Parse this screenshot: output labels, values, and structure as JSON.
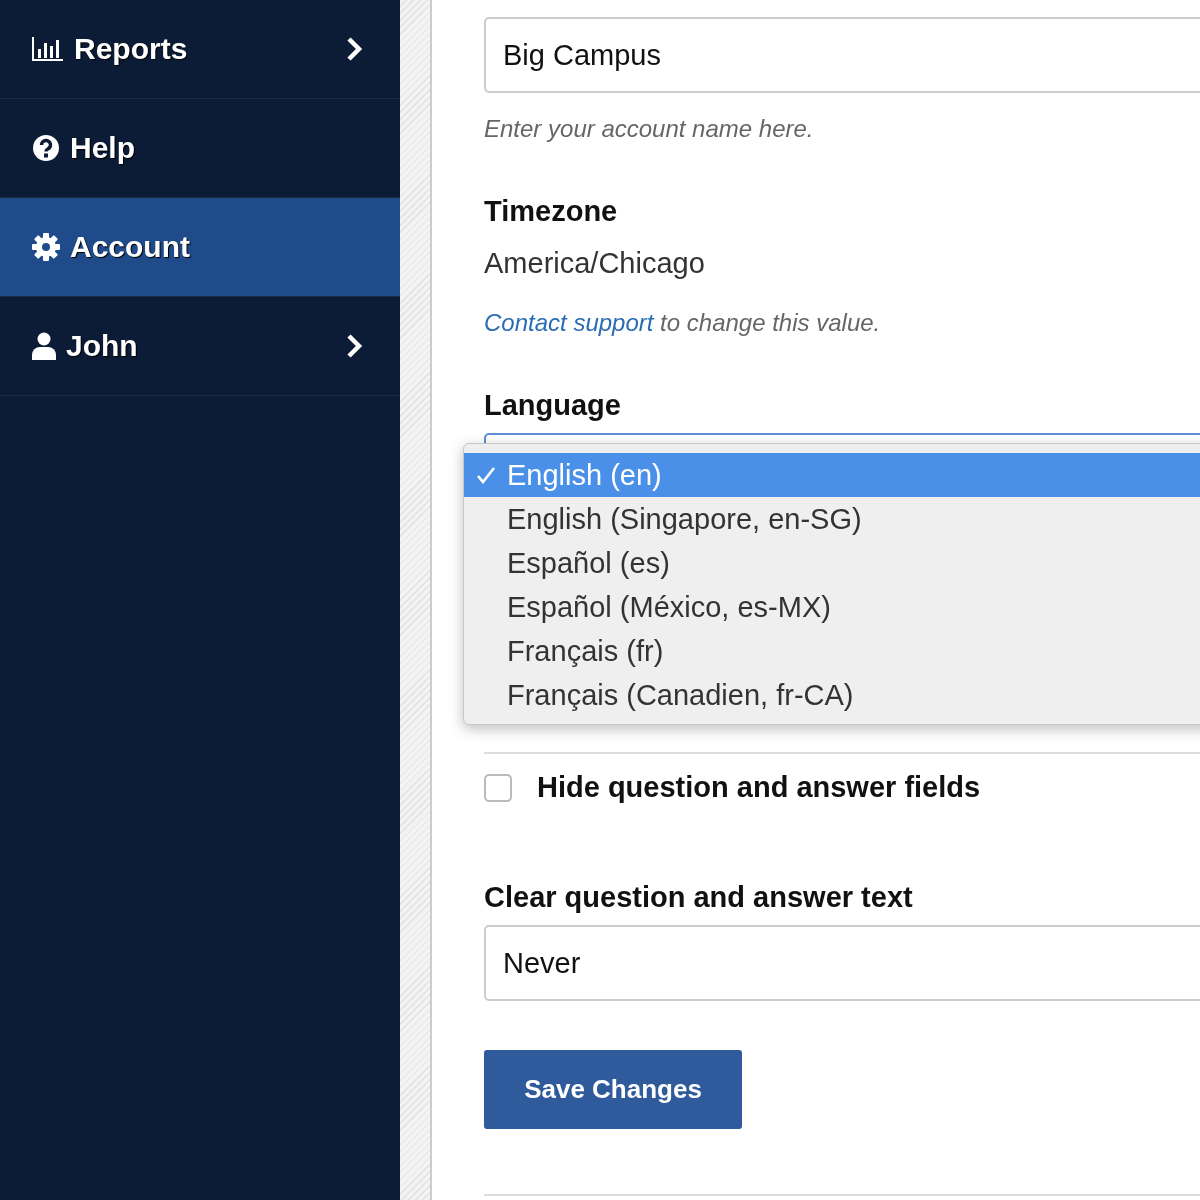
{
  "sidebar": {
    "items": [
      {
        "label": "Reports",
        "kind": "chart",
        "has_submenu": true,
        "selected": false
      },
      {
        "label": "Help",
        "kind": "help",
        "has_submenu": false,
        "selected": false
      },
      {
        "label": "Account",
        "kind": "gear",
        "has_submenu": false,
        "selected": true
      },
      {
        "label": "John",
        "kind": "user",
        "has_submenu": true,
        "selected": false
      }
    ]
  },
  "form": {
    "account_name": {
      "value": "Big Campus",
      "help": "Enter your account name here."
    },
    "timezone": {
      "label": "Timezone",
      "value": "America/Chicago",
      "help_link": "Contact support",
      "help_text": "to change this value."
    },
    "language": {
      "label": "Language",
      "options": [
        {
          "label": "English (en)",
          "selected": true
        },
        {
          "label": "English (Singapore, en-SG)",
          "selected": false
        },
        {
          "label": "Español (es)",
          "selected": false
        },
        {
          "label": "Español (México, es-MX)",
          "selected": false
        },
        {
          "label": "Français (fr)",
          "selected": false
        },
        {
          "label": "Français (Canadien, fr-CA)",
          "selected": false
        }
      ]
    },
    "checkboxes": [
      {
        "label": "Hide question and answer fields",
        "checked": false
      }
    ],
    "clear_text": {
      "label": "Clear question and answer text",
      "value": "Never"
    },
    "save_button": "Save Changes"
  }
}
